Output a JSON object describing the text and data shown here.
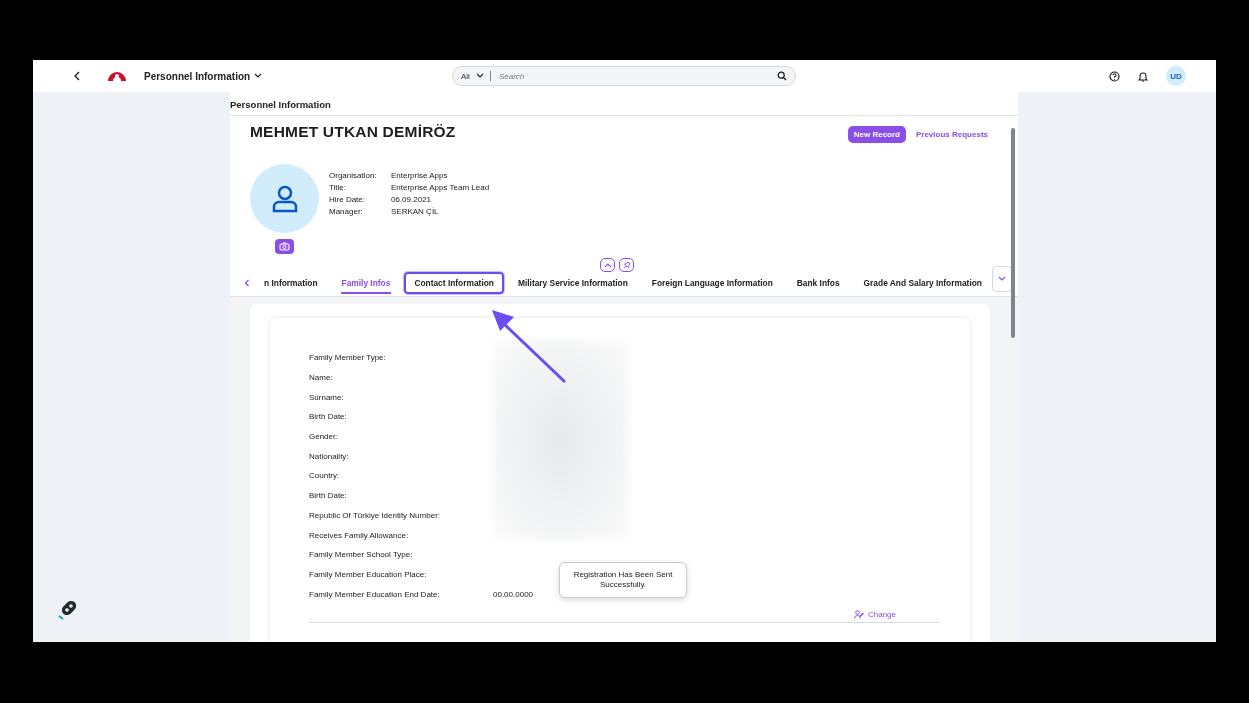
{
  "shell": {
    "app_title": "Personnel Information",
    "search_scope": "All",
    "search_placeholder": "Search",
    "user_initials": "UD"
  },
  "page_title": "Personnel Information",
  "employee": {
    "name": "MEHMET UTKAN DEMİRÖZ",
    "actions": [
      {
        "label": "New Record",
        "kind": "primary"
      },
      {
        "label": "Previous Requests",
        "kind": "link"
      }
    ],
    "fields": [
      {
        "label": "Organisation:",
        "value": "Enterprise Apps"
      },
      {
        "label": "Title:",
        "value": "Enterprise Apps Team Lead"
      },
      {
        "label": "Hire Date:",
        "value": "06.09.2021"
      },
      {
        "label": "Manager:",
        "value": "SERKAN ÇİL"
      }
    ]
  },
  "tabs": [
    {
      "label": "n Information",
      "selected": false,
      "highlighted": false
    },
    {
      "label": "Family Infos",
      "selected": true,
      "highlighted": false
    },
    {
      "label": "Contact Information",
      "selected": false,
      "highlighted": true
    },
    {
      "label": "Military Service Information",
      "selected": false,
      "highlighted": false
    },
    {
      "label": "Foreign Language Information",
      "selected": false,
      "highlighted": false
    },
    {
      "label": "Bank Infos",
      "selected": false,
      "highlighted": false
    },
    {
      "label": "Grade And Salary Information",
      "selected": false,
      "highlighted": false
    }
  ],
  "family_form": {
    "rows": [
      {
        "label": "Family Member Type:"
      },
      {
        "label": "Name:"
      },
      {
        "label": "Surname:"
      },
      {
        "label": "Birth Date:"
      },
      {
        "label": "Gender:"
      },
      {
        "label": "Nationality:"
      },
      {
        "label": "Country:"
      },
      {
        "label": "Birth Date:"
      },
      {
        "label": "Republic Of Türkiye Identity Number:"
      },
      {
        "label": "Receives Family Allowance:"
      },
      {
        "label": "Family Member School Type:"
      },
      {
        "label": "Family Member Education Place:"
      },
      {
        "label": "Family Member Education End Date:",
        "value": "00.00.0000"
      }
    ],
    "change_button": "Change"
  },
  "toast": "Registration Has Been Sent Successfully."
}
